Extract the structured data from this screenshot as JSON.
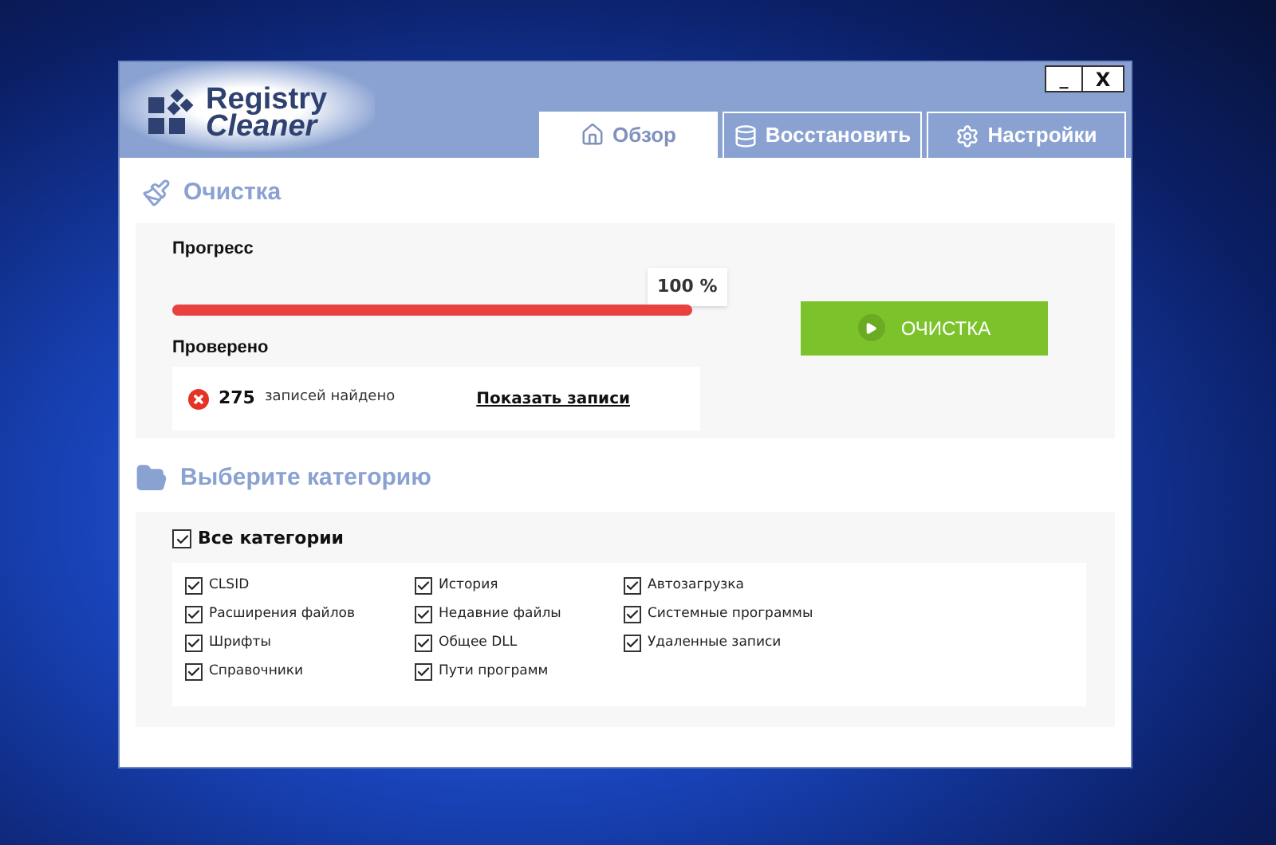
{
  "window": {
    "logo_line_1": "Registry",
    "logo_line_2": "Cleaner",
    "minimize": "_",
    "close": "X"
  },
  "tabs": [
    {
      "label": "Обзор",
      "selected": true
    },
    {
      "label": "Восстановить",
      "selected": false
    },
    {
      "label": "Настройки",
      "selected": false
    }
  ],
  "clean_section": {
    "title": "Очистка",
    "progress_label": "Прогресс",
    "level": 1,
    "progress_reading": "100 %",
    "checked_label": "Проверено",
    "found_count": "275",
    "found_text": "записей найдено",
    "show_link": "Показать записи",
    "button": "ОЧИСТКА"
  },
  "category_section": {
    "title": "Выберите категорию",
    "all": {
      "label": "Все категории",
      "checked": true
    },
    "columns": [
      [
        {
          "label": "CLSID",
          "checked": true
        },
        {
          "label": "Расширения файлов",
          "checked": true
        },
        {
          "label": "Шрифты",
          "checked": true
        },
        {
          "label": "Справочники",
          "checked": true
        }
      ],
      [
        {
          "label": "История",
          "checked": true
        },
        {
          "label": "Недавние файлы",
          "checked": true
        },
        {
          "label": "Общее DLL",
          "checked": true
        },
        {
          "label": "Пути программ",
          "checked": true
        }
      ],
      [
        {
          "label": "Автозагрузка",
          "checked": true
        },
        {
          "label": "Системные программы",
          "checked": true
        },
        {
          "label": "Удаленные записи",
          "checked": true
        }
      ]
    ]
  }
}
